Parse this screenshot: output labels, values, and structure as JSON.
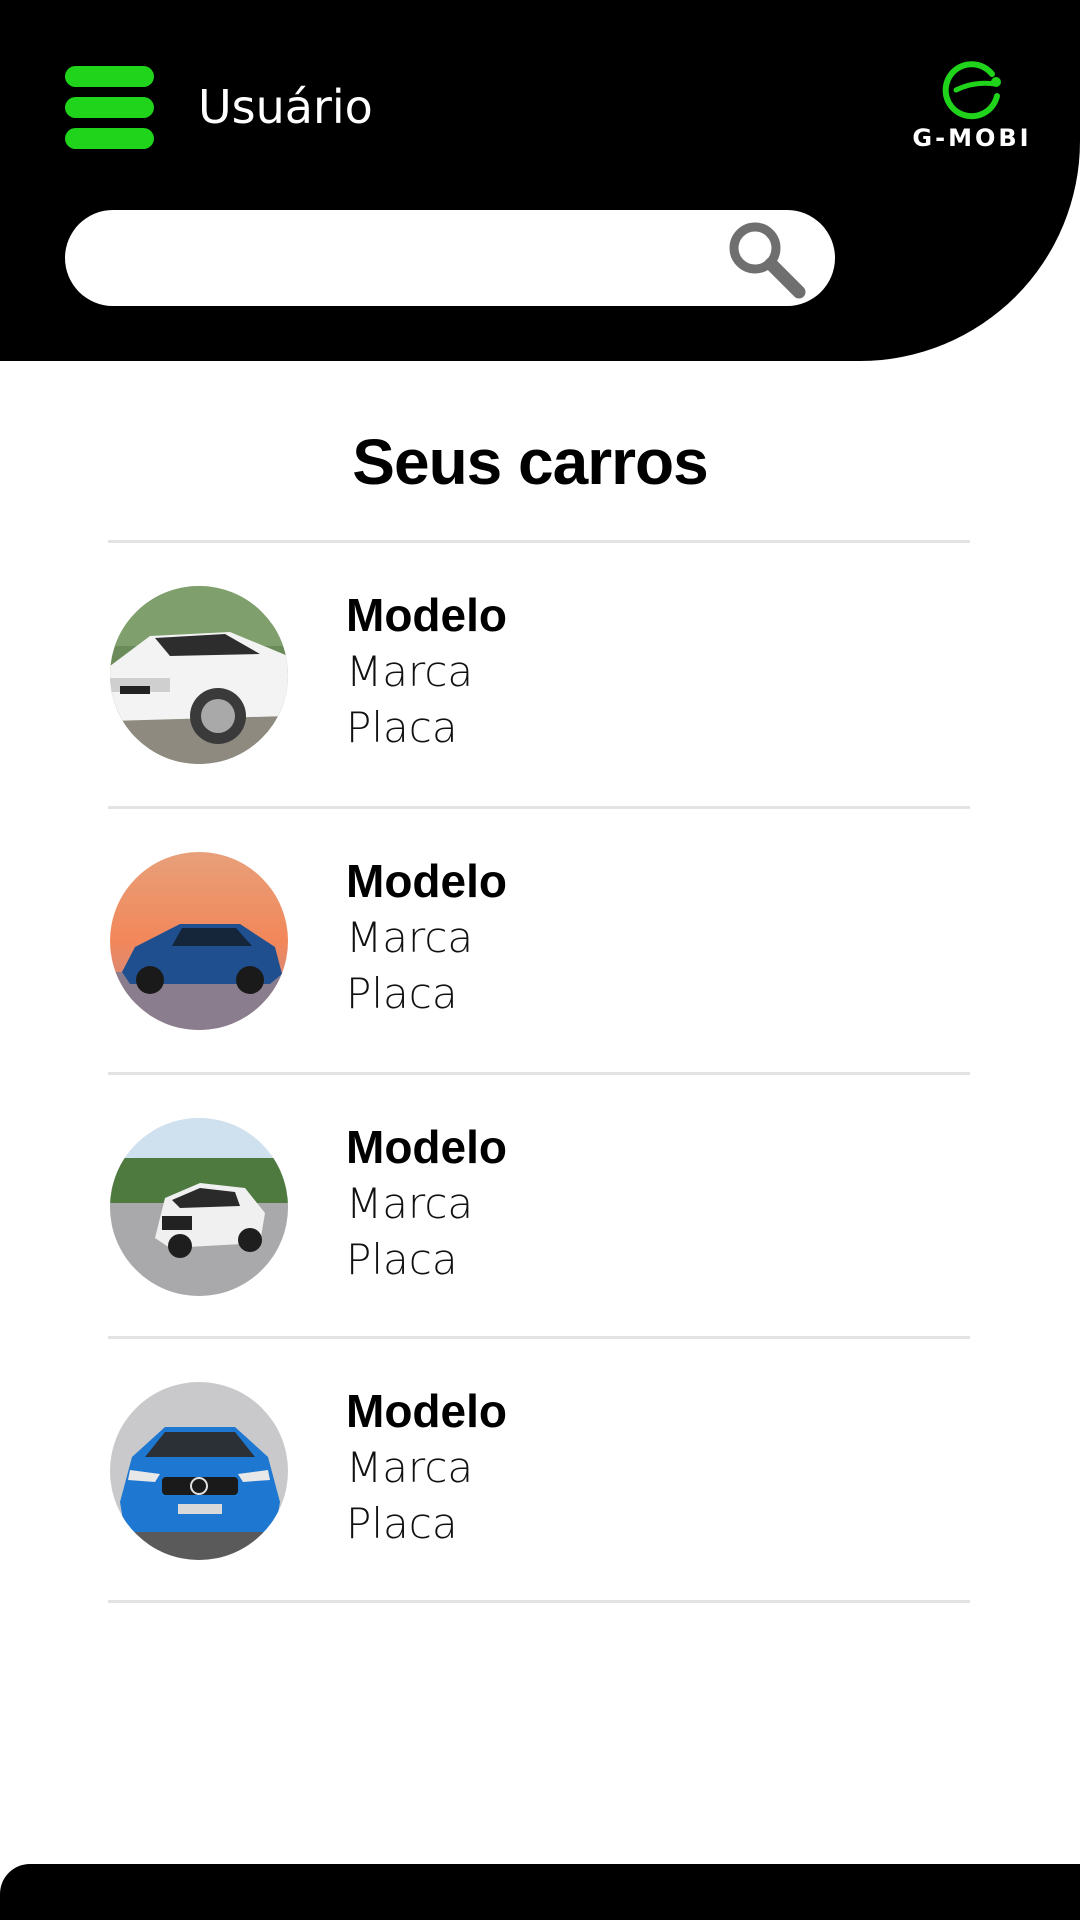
{
  "header": {
    "user_label": "Usuário",
    "logo_text": "G-MOBI",
    "menu_icon": "hamburger-icon",
    "accent_color": "#1fd41a"
  },
  "search": {
    "value": "",
    "icon": "search-icon"
  },
  "main": {
    "title": "Seus carros",
    "cars": [
      {
        "model": "Modelo",
        "brand": "Marca",
        "plate": "Placa",
        "photo": "white-suv-photo"
      },
      {
        "model": "Modelo",
        "brand": "Marca",
        "plate": "Placa",
        "photo": "blue-coupe-photo"
      },
      {
        "model": "Modelo",
        "brand": "Marca",
        "plate": "Placa",
        "photo": "white-suv-road-photo"
      },
      {
        "model": "Modelo",
        "brand": "Marca",
        "plate": "Placa",
        "photo": "blue-hatchback-photo"
      }
    ]
  }
}
